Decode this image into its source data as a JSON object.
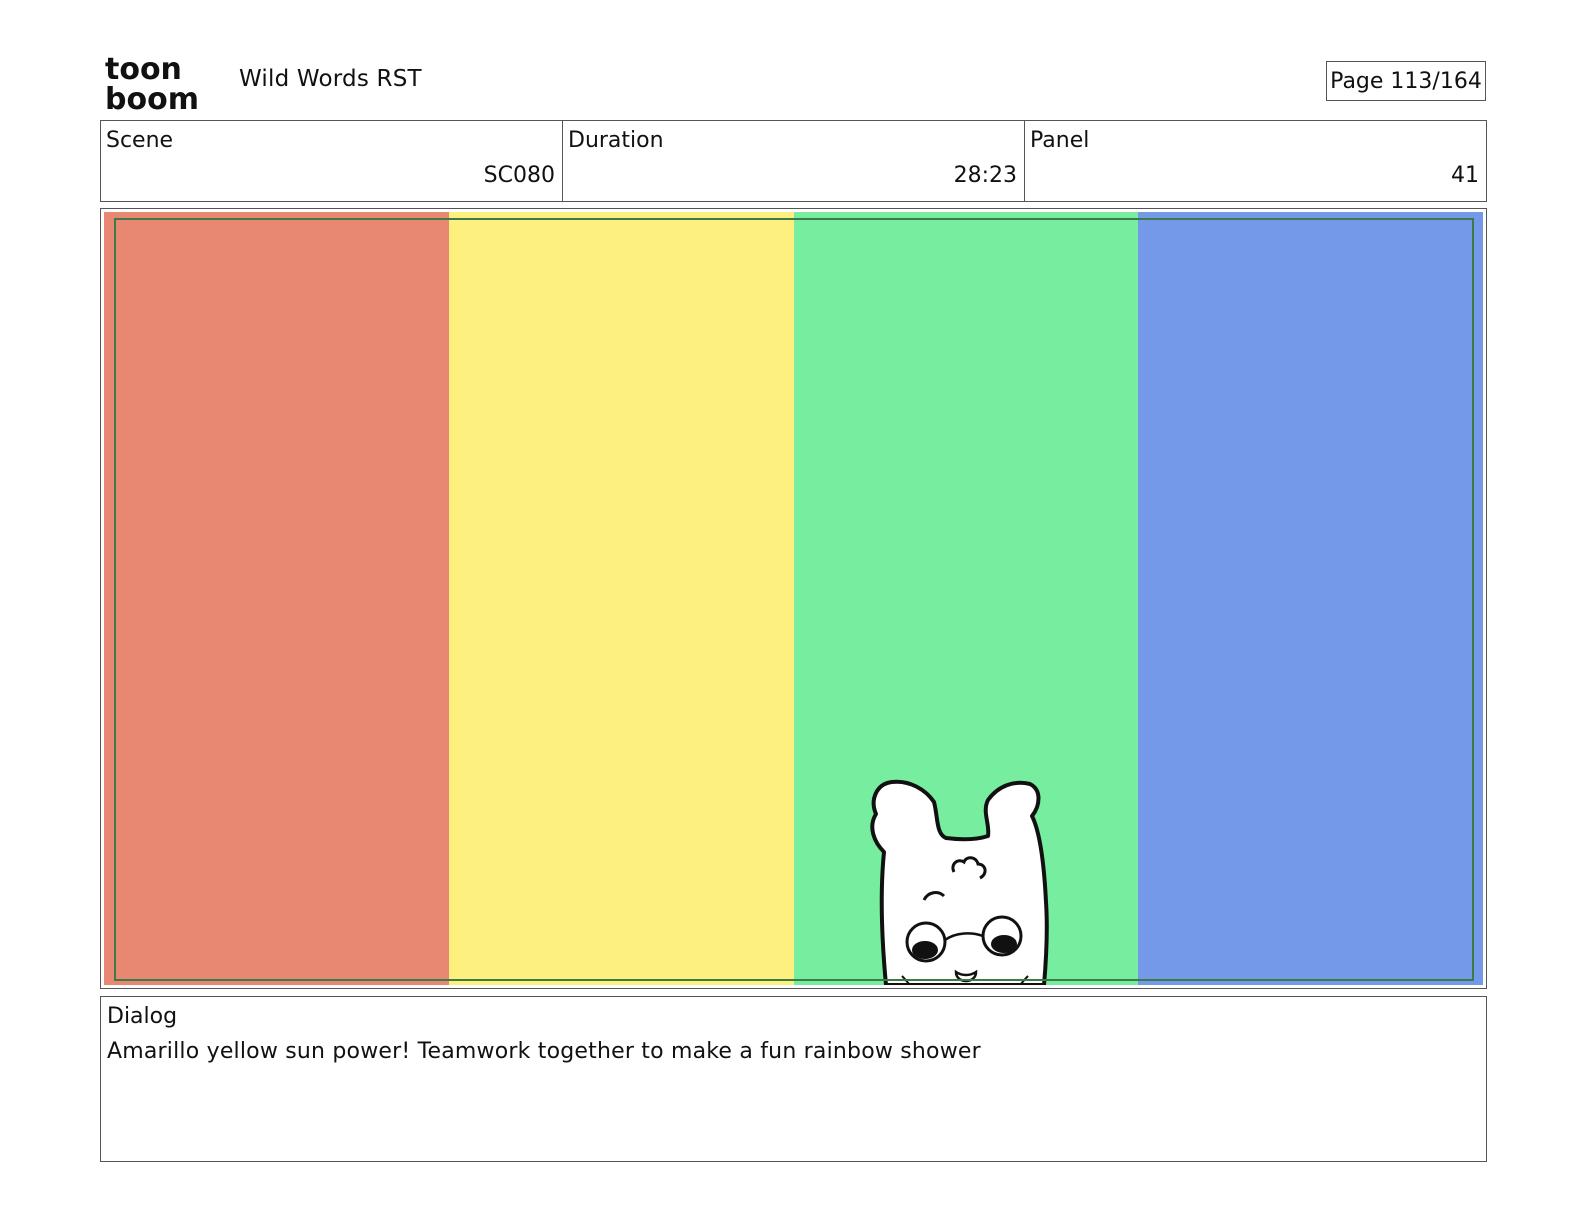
{
  "header": {
    "logo_top": "toon",
    "logo_bottom": "boom",
    "title": "Wild Words RST",
    "page_label": "Page 113/164"
  },
  "info": {
    "scene_label": "Scene",
    "scene_value": "SC080",
    "duration_label": "Duration",
    "duration_value": "28:23",
    "panel_label": "Panel",
    "panel_value": "41"
  },
  "panel": {
    "stripes": [
      "#e88872",
      "#fdf07e",
      "#77ee9f",
      "#7399e8"
    ],
    "safe_frame_color": "#3c7a4a"
  },
  "dialog": {
    "label": "Dialog",
    "text": "Amarillo yellow sun power! Teamwork together to make a fun rainbow shower"
  }
}
